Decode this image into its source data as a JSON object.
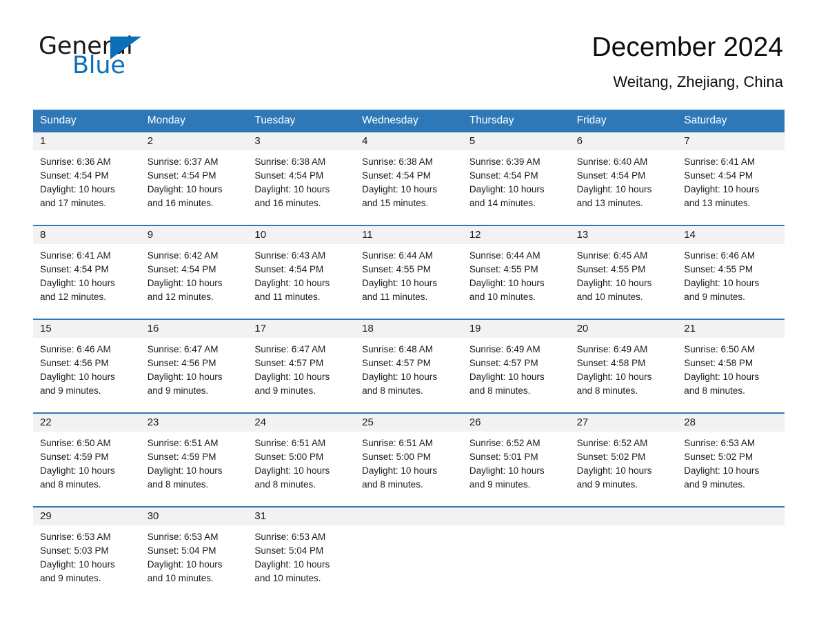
{
  "brand": {
    "word_one": "General",
    "word_two": "Blue",
    "triangle_color": "#0a6fba"
  },
  "header": {
    "title": "December 2024",
    "location": "Weitang, Zhejiang, China"
  },
  "theme": {
    "header_blue": "#2e78b8",
    "daynum_band": "#f2f2f2",
    "text": "#1a1a1a"
  },
  "weekdays": [
    "Sunday",
    "Monday",
    "Tuesday",
    "Wednesday",
    "Thursday",
    "Friday",
    "Saturday"
  ],
  "weeks": [
    {
      "days": [
        {
          "num": "1",
          "sunrise": "Sunrise: 6:36 AM",
          "sunset": "Sunset: 4:54 PM",
          "daylight1": "Daylight: 10 hours",
          "daylight2": "and 17 minutes."
        },
        {
          "num": "2",
          "sunrise": "Sunrise: 6:37 AM",
          "sunset": "Sunset: 4:54 PM",
          "daylight1": "Daylight: 10 hours",
          "daylight2": "and 16 minutes."
        },
        {
          "num": "3",
          "sunrise": "Sunrise: 6:38 AM",
          "sunset": "Sunset: 4:54 PM",
          "daylight1": "Daylight: 10 hours",
          "daylight2": "and 16 minutes."
        },
        {
          "num": "4",
          "sunrise": "Sunrise: 6:38 AM",
          "sunset": "Sunset: 4:54 PM",
          "daylight1": "Daylight: 10 hours",
          "daylight2": "and 15 minutes."
        },
        {
          "num": "5",
          "sunrise": "Sunrise: 6:39 AM",
          "sunset": "Sunset: 4:54 PM",
          "daylight1": "Daylight: 10 hours",
          "daylight2": "and 14 minutes."
        },
        {
          "num": "6",
          "sunrise": "Sunrise: 6:40 AM",
          "sunset": "Sunset: 4:54 PM",
          "daylight1": "Daylight: 10 hours",
          "daylight2": "and 13 minutes."
        },
        {
          "num": "7",
          "sunrise": "Sunrise: 6:41 AM",
          "sunset": "Sunset: 4:54 PM",
          "daylight1": "Daylight: 10 hours",
          "daylight2": "and 13 minutes."
        }
      ]
    },
    {
      "days": [
        {
          "num": "8",
          "sunrise": "Sunrise: 6:41 AM",
          "sunset": "Sunset: 4:54 PM",
          "daylight1": "Daylight: 10 hours",
          "daylight2": "and 12 minutes."
        },
        {
          "num": "9",
          "sunrise": "Sunrise: 6:42 AM",
          "sunset": "Sunset: 4:54 PM",
          "daylight1": "Daylight: 10 hours",
          "daylight2": "and 12 minutes."
        },
        {
          "num": "10",
          "sunrise": "Sunrise: 6:43 AM",
          "sunset": "Sunset: 4:54 PM",
          "daylight1": "Daylight: 10 hours",
          "daylight2": "and 11 minutes."
        },
        {
          "num": "11",
          "sunrise": "Sunrise: 6:44 AM",
          "sunset": "Sunset: 4:55 PM",
          "daylight1": "Daylight: 10 hours",
          "daylight2": "and 11 minutes."
        },
        {
          "num": "12",
          "sunrise": "Sunrise: 6:44 AM",
          "sunset": "Sunset: 4:55 PM",
          "daylight1": "Daylight: 10 hours",
          "daylight2": "and 10 minutes."
        },
        {
          "num": "13",
          "sunrise": "Sunrise: 6:45 AM",
          "sunset": "Sunset: 4:55 PM",
          "daylight1": "Daylight: 10 hours",
          "daylight2": "and 10 minutes."
        },
        {
          "num": "14",
          "sunrise": "Sunrise: 6:46 AM",
          "sunset": "Sunset: 4:55 PM",
          "daylight1": "Daylight: 10 hours",
          "daylight2": "and 9 minutes."
        }
      ]
    },
    {
      "days": [
        {
          "num": "15",
          "sunrise": "Sunrise: 6:46 AM",
          "sunset": "Sunset: 4:56 PM",
          "daylight1": "Daylight: 10 hours",
          "daylight2": "and 9 minutes."
        },
        {
          "num": "16",
          "sunrise": "Sunrise: 6:47 AM",
          "sunset": "Sunset: 4:56 PM",
          "daylight1": "Daylight: 10 hours",
          "daylight2": "and 9 minutes."
        },
        {
          "num": "17",
          "sunrise": "Sunrise: 6:47 AM",
          "sunset": "Sunset: 4:57 PM",
          "daylight1": "Daylight: 10 hours",
          "daylight2": "and 9 minutes."
        },
        {
          "num": "18",
          "sunrise": "Sunrise: 6:48 AM",
          "sunset": "Sunset: 4:57 PM",
          "daylight1": "Daylight: 10 hours",
          "daylight2": "and 8 minutes."
        },
        {
          "num": "19",
          "sunrise": "Sunrise: 6:49 AM",
          "sunset": "Sunset: 4:57 PM",
          "daylight1": "Daylight: 10 hours",
          "daylight2": "and 8 minutes."
        },
        {
          "num": "20",
          "sunrise": "Sunrise: 6:49 AM",
          "sunset": "Sunset: 4:58 PM",
          "daylight1": "Daylight: 10 hours",
          "daylight2": "and 8 minutes."
        },
        {
          "num": "21",
          "sunrise": "Sunrise: 6:50 AM",
          "sunset": "Sunset: 4:58 PM",
          "daylight1": "Daylight: 10 hours",
          "daylight2": "and 8 minutes."
        }
      ]
    },
    {
      "days": [
        {
          "num": "22",
          "sunrise": "Sunrise: 6:50 AM",
          "sunset": "Sunset: 4:59 PM",
          "daylight1": "Daylight: 10 hours",
          "daylight2": "and 8 minutes."
        },
        {
          "num": "23",
          "sunrise": "Sunrise: 6:51 AM",
          "sunset": "Sunset: 4:59 PM",
          "daylight1": "Daylight: 10 hours",
          "daylight2": "and 8 minutes."
        },
        {
          "num": "24",
          "sunrise": "Sunrise: 6:51 AM",
          "sunset": "Sunset: 5:00 PM",
          "daylight1": "Daylight: 10 hours",
          "daylight2": "and 8 minutes."
        },
        {
          "num": "25",
          "sunrise": "Sunrise: 6:51 AM",
          "sunset": "Sunset: 5:00 PM",
          "daylight1": "Daylight: 10 hours",
          "daylight2": "and 8 minutes."
        },
        {
          "num": "26",
          "sunrise": "Sunrise: 6:52 AM",
          "sunset": "Sunset: 5:01 PM",
          "daylight1": "Daylight: 10 hours",
          "daylight2": "and 9 minutes."
        },
        {
          "num": "27",
          "sunrise": "Sunrise: 6:52 AM",
          "sunset": "Sunset: 5:02 PM",
          "daylight1": "Daylight: 10 hours",
          "daylight2": "and 9 minutes."
        },
        {
          "num": "28",
          "sunrise": "Sunrise: 6:53 AM",
          "sunset": "Sunset: 5:02 PM",
          "daylight1": "Daylight: 10 hours",
          "daylight2": "and 9 minutes."
        }
      ]
    },
    {
      "days": [
        {
          "num": "29",
          "sunrise": "Sunrise: 6:53 AM",
          "sunset": "Sunset: 5:03 PM",
          "daylight1": "Daylight: 10 hours",
          "daylight2": "and 9 minutes."
        },
        {
          "num": "30",
          "sunrise": "Sunrise: 6:53 AM",
          "sunset": "Sunset: 5:04 PM",
          "daylight1": "Daylight: 10 hours",
          "daylight2": "and 10 minutes."
        },
        {
          "num": "31",
          "sunrise": "Sunrise: 6:53 AM",
          "sunset": "Sunset: 5:04 PM",
          "daylight1": "Daylight: 10 hours",
          "daylight2": "and 10 minutes."
        },
        {
          "num": "",
          "sunrise": "",
          "sunset": "",
          "daylight1": "",
          "daylight2": ""
        },
        {
          "num": "",
          "sunrise": "",
          "sunset": "",
          "daylight1": "",
          "daylight2": ""
        },
        {
          "num": "",
          "sunrise": "",
          "sunset": "",
          "daylight1": "",
          "daylight2": ""
        },
        {
          "num": "",
          "sunrise": "",
          "sunset": "",
          "daylight1": "",
          "daylight2": ""
        }
      ]
    }
  ]
}
